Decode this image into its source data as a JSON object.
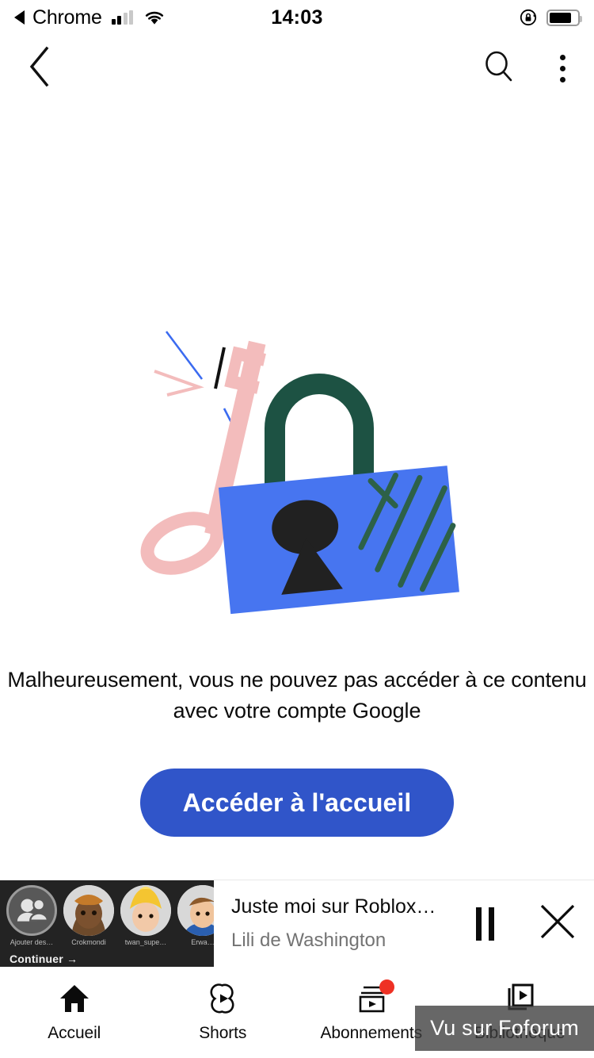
{
  "status_bar": {
    "back_app_label": "Chrome",
    "back_caret_icon": "left-caret-icon",
    "signal_icon": "cellular-signal-icon",
    "signal_bars_active": 2,
    "signal_bars_total": 4,
    "wifi_icon": "wifi-icon",
    "time": "14:03",
    "rotation_lock_icon": "rotation-lock-icon",
    "battery_icon": "battery-icon",
    "battery_level_percent": 78
  },
  "app_bar": {
    "back_icon": "back-chevron-icon",
    "search_icon": "search-icon",
    "overflow_icon": "more-vertical-icon"
  },
  "main": {
    "illustration": {
      "name": "locked-padlock-and-key-illustration",
      "colors": {
        "key": "#f3bcbc",
        "lock_body": "#4775f0",
        "lock_shackle": "#1d5243",
        "keyhole": "#212121",
        "spark_blue": "#3b6bf0",
        "hatch_green": "#2d6148"
      }
    },
    "message": "Malheureusement, vous ne pouvez pas accéder à ce contenu avec votre compte Google",
    "cta_label": "Accéder à l'accueil",
    "cta_color": "#3055c9"
  },
  "miniplayer": {
    "title": "Juste moi sur Roblox…",
    "channel": "Lili de Washington",
    "pause_icon": "pause-icon",
    "close_icon": "close-icon",
    "thumbnail": {
      "continue_label": "Continuer →",
      "avatars": [
        {
          "label": "Ajouter des…",
          "icon": "add-friends-icon"
        },
        {
          "label": "Crokmondi",
          "icon": "avatar"
        },
        {
          "label": "twan_supe…",
          "icon": "avatar"
        },
        {
          "label": "Erwa…",
          "icon": "avatar"
        }
      ]
    }
  },
  "bottom_nav": {
    "items": [
      {
        "label": "Accueil",
        "icon": "home-icon",
        "active": true,
        "badge": false
      },
      {
        "label": "Shorts",
        "icon": "shorts-icon",
        "active": false,
        "badge": false
      },
      {
        "label": "Abonnements",
        "icon": "subscriptions-icon",
        "active": false,
        "badge": true
      },
      {
        "label": "Bibliothèque",
        "icon": "library-icon",
        "active": false,
        "badge": false
      }
    ],
    "badge_color": "#ee3124"
  },
  "watermark": {
    "text": "Vu sur Foforum"
  }
}
